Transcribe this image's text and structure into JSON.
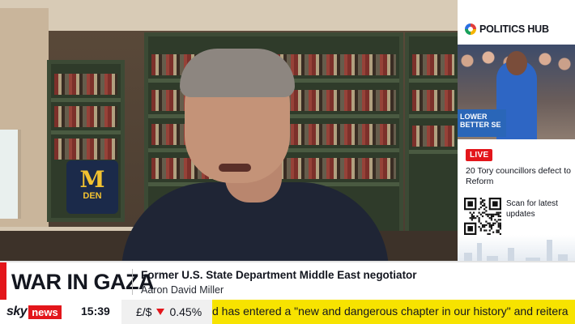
{
  "panel": {
    "title": "POLITICS HUB",
    "photo_sign": "LOWER BETTER SE",
    "live_label": "LIVE",
    "story": "20 Tory councillors defect to Reform",
    "scan_text": "Scan for latest updates"
  },
  "scene": {
    "bag_letter": "M",
    "bag_text": "DEN"
  },
  "lower_third": {
    "section": "WAR IN GAZA",
    "headline": "Former U.S. State Department Middle East negotiator",
    "name": "Aaron David Miller"
  },
  "ticker": {
    "brand_sky": "sky",
    "brand_news": "news",
    "time": "15:39",
    "market_pair": "£/$",
    "market_change": "0.45%",
    "crawl": "d has entered a \"new and dangerous chapter in our history\" and reitera"
  },
  "colors": {
    "accent_red": "#e3161b",
    "crawl_yellow": "#f7e300",
    "text_dark": "#13161f"
  },
  "icons": {
    "hub_logo": "politics-hub-icon",
    "qr": "qr-code-icon",
    "market_direction": "down-arrow-icon"
  }
}
